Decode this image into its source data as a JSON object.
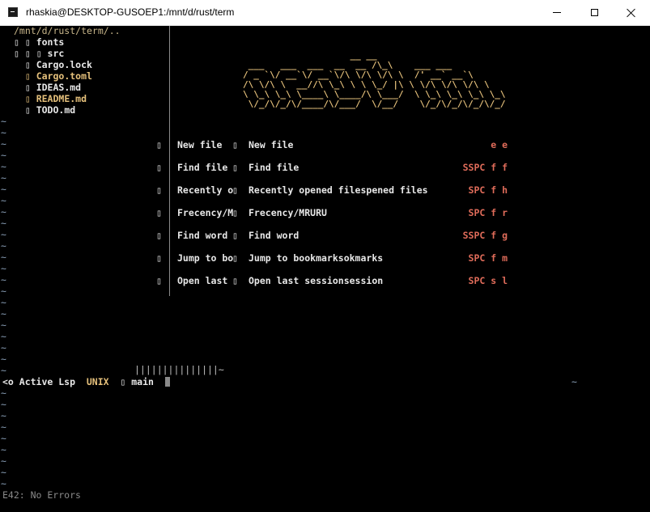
{
  "window": {
    "title": "rhaskia@DESKTOP-GUSOEP1:/mnt/d/rust/term",
    "icon": "terminal-icon",
    "controls": [
      "minimize",
      "maximize",
      "close"
    ]
  },
  "tree": {
    "root": "/mnt/d/rust/term/..",
    "items": [
      {
        "prefix": "▯ ▯ ",
        "name": "fonts",
        "color": "#e8e8e8"
      },
      {
        "prefix": "▯ ▯ ▯ ",
        "name": "src",
        "color": "#e8e8e8"
      },
      {
        "prefix": "  ▯ ",
        "name": "Cargo.lock",
        "color": "#e8e8e8"
      },
      {
        "prefix": "  ▯ ",
        "name": "Cargo.toml",
        "color": "#e5c07b"
      },
      {
        "prefix": "  ▯ ",
        "name": "IDEAS.md",
        "color": "#e8e8e8"
      },
      {
        "prefix": "  ▯ ",
        "name": "README.md",
        "color": "#e5c07b"
      },
      {
        "prefix": "  ▯ ",
        "name": "TODO.md",
        "color": "#e8e8e8"
      }
    ]
  },
  "banner": {
    "lines": [
      "                    __ __            ",
      " ___   ___  ___  __  __ /\\_\\    ___ ___   ",
      "/ _ `\\/ __`\\/ __`\\/\\ \\/\\ \\/\\ \\  /' __` __`\\ ",
      "/\\ \\/\\ \\  __//\\ \\_\\ \\ \\ \\_/ |\\ \\ \\/\\ \\/\\ \\/\\ \\",
      "\\ \\_\\ \\_\\ \\____\\ \\____/\\ \\___/  \\ \\_\\ \\_\\ \\_\\ \\_\\",
      " \\/_/\\/_/\\/____/\\/___/  \\/__/    \\/_/\\/_/\\/_/\\/_/"
    ]
  },
  "dashboard": {
    "glyph": "▯",
    "items": [
      {
        "label1": "New file ",
        "label2": "New file",
        "key": "e e"
      },
      {
        "label1": "Find file",
        "label2": "Find file",
        "key": "SSPC f f"
      },
      {
        "label1": "Recently o",
        "label2": "Recently opened filespened files",
        "key": "SPC f h"
      },
      {
        "label1": "Frecency/M",
        "label2": "Frecency/MRURU",
        "key": "SPC f r"
      },
      {
        "label1": "Find word",
        "label2": "Find word",
        "key": "SSPC f g"
      },
      {
        "label1": "Jump to bo",
        "label2": "Jump to bookmarksokmarks",
        "key": "SPC f m"
      },
      {
        "label1": "Open last",
        "label2": "Open last sessionsession",
        "key": "SPC s l"
      }
    ]
  },
  "tilde_char": "~",
  "hbar_text": "|||||||||||||||~",
  "statusline": {
    "prefix": "<o Active Lsp  ",
    "encoding": "UNIX",
    "branch": "  ▯ main  "
  },
  "status_tilde": "~",
  "cmdline": "E42: No Errors",
  "colors": {
    "background": "#000000",
    "accent_yellow": "#e5c07b",
    "key_red": "#e06c5a",
    "tilde_blue": "#8aa0b8",
    "text": "#e8e8e8"
  }
}
